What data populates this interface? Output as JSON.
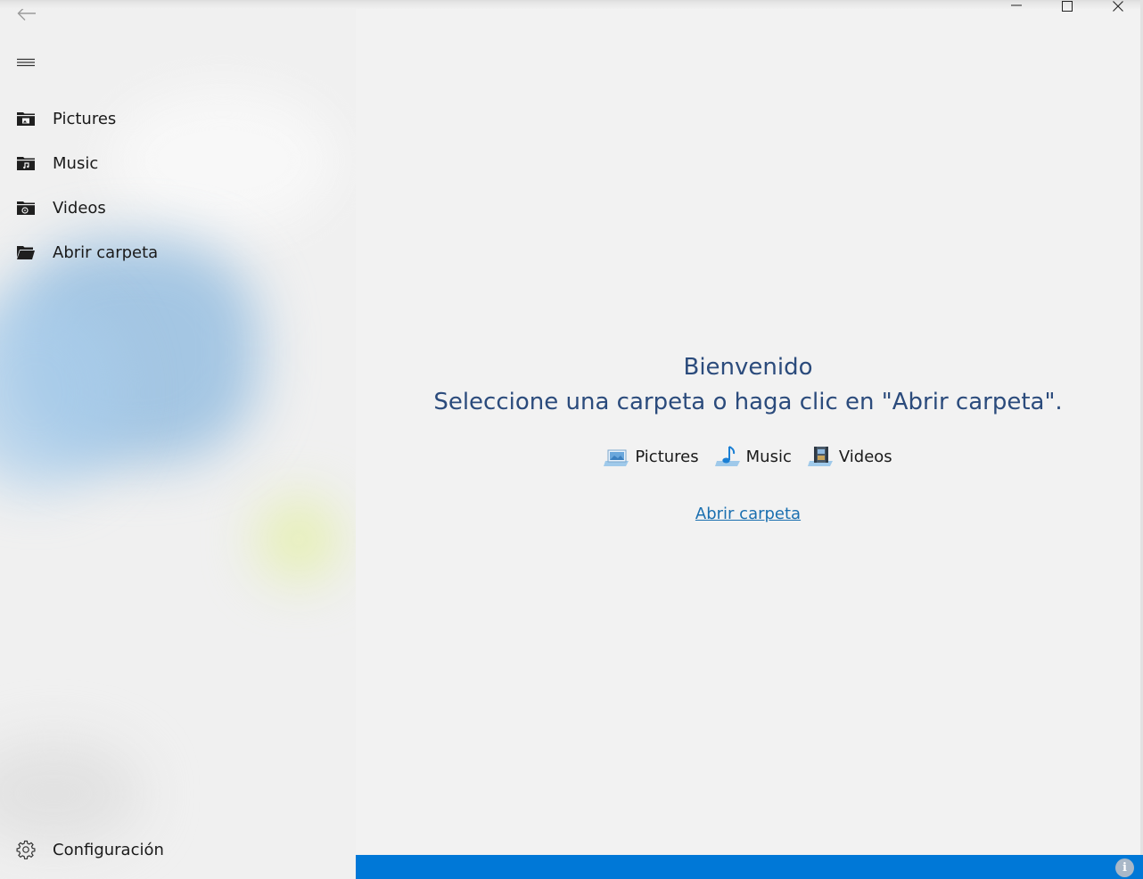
{
  "sidebar": {
    "back_icon": "back-arrow-icon",
    "menu_icon": "hamburger-menu-icon",
    "items": [
      {
        "label": "Pictures",
        "icon": "pictures-folder-icon"
      },
      {
        "label": "Music",
        "icon": "music-folder-icon"
      },
      {
        "label": "Videos",
        "icon": "videos-folder-icon"
      },
      {
        "label": "Abrir carpeta",
        "icon": "open-folder-icon"
      }
    ],
    "settings": {
      "label": "Configuración",
      "icon": "gear-icon"
    }
  },
  "titlebar": {
    "controls": [
      "minimize-icon",
      "maximize-icon",
      "close-icon"
    ]
  },
  "main": {
    "title": "Bienvenido",
    "subtitle": "Seleccione una carpeta o haga clic en \"Abrir carpeta\".",
    "quick_links": [
      {
        "label": "Pictures",
        "icon": "pictures-library-icon"
      },
      {
        "label": "Music",
        "icon": "music-library-icon"
      },
      {
        "label": "Videos",
        "icon": "videos-library-icon"
      }
    ],
    "open_folder_link": "Abrir carpeta"
  },
  "status_bar": {
    "info_glyph": "i",
    "accent_color": "#0078d7"
  },
  "colors": {
    "heading": "#2b4b7c",
    "link": "#1a6fb0",
    "background": "#f2f2f2"
  }
}
